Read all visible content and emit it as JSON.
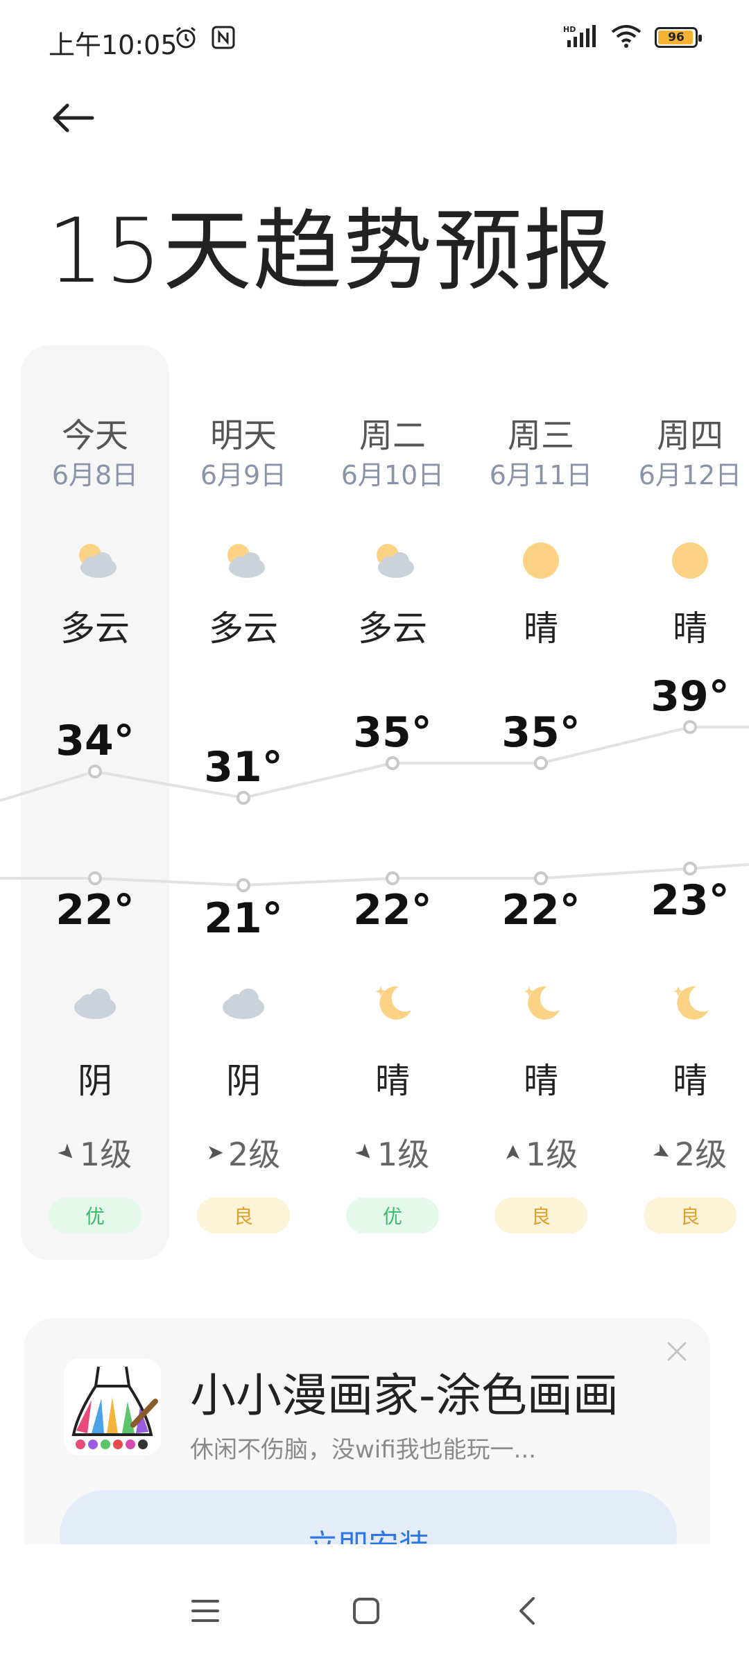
{
  "status_bar": {
    "time": "上午10:05",
    "icons": [
      "alarm-icon",
      "nfc-icon",
      "hd-signal-icon",
      "wifi-icon"
    ],
    "battery": {
      "level": 96,
      "label": "96",
      "color": "#f5b335"
    }
  },
  "header": {
    "back_icon": "arrow-left-icon",
    "title": "15天趋势预报"
  },
  "forecast": {
    "days": [
      {
        "label": "今天",
        "date": "6月8日",
        "day_icon": "partly-cloudy-icon",
        "day_desc": "多云",
        "high": "34°",
        "low": "22°",
        "night_icon": "cloudy-icon",
        "night_desc": "阴",
        "wind_dir": "northeast",
        "wind": "1级",
        "aqi": "优",
        "aqi_level": "good"
      },
      {
        "label": "明天",
        "date": "6月9日",
        "day_icon": "partly-cloudy-icon",
        "day_desc": "多云",
        "high": "31°",
        "low": "21°",
        "night_icon": "cloudy-icon",
        "night_desc": "阴",
        "wind_dir": "east",
        "wind": "2级",
        "aqi": "良",
        "aqi_level": "fair"
      },
      {
        "label": "周二",
        "date": "6月10日",
        "day_icon": "partly-cloudy-icon",
        "day_desc": "多云",
        "high": "35°",
        "low": "22°",
        "night_icon": "moon-icon",
        "night_desc": "晴",
        "wind_dir": "northeast",
        "wind": "1级",
        "aqi": "优",
        "aqi_level": "good"
      },
      {
        "label": "周三",
        "date": "6月11日",
        "day_icon": "sun-icon",
        "day_desc": "晴",
        "high": "35°",
        "low": "22°",
        "night_icon": "moon-icon",
        "night_desc": "晴",
        "wind_dir": "north",
        "wind": "1级",
        "aqi": "良",
        "aqi_level": "fair"
      },
      {
        "label": "周四",
        "date": "6月12日",
        "day_icon": "sun-icon",
        "day_desc": "晴",
        "high": "39°",
        "low": "23°",
        "night_icon": "moon-icon",
        "night_desc": "晴",
        "wind_dir": "southeast",
        "wind": "2级",
        "aqi": "良",
        "aqi_level": "fair"
      }
    ],
    "high_temps": [
      34,
      31,
      35,
      35,
      39
    ],
    "low_temps": [
      22,
      21,
      22,
      22,
      23
    ]
  },
  "ad": {
    "title": "小小漫画家-涂色画画",
    "subtitle": "休闲不伤脑，没wifi我也能玩一...",
    "install_label": "立即安装",
    "close_icon": "close-icon"
  },
  "nav_bar": {
    "icons": [
      "menu-icon",
      "home-icon",
      "back-icon"
    ]
  }
}
